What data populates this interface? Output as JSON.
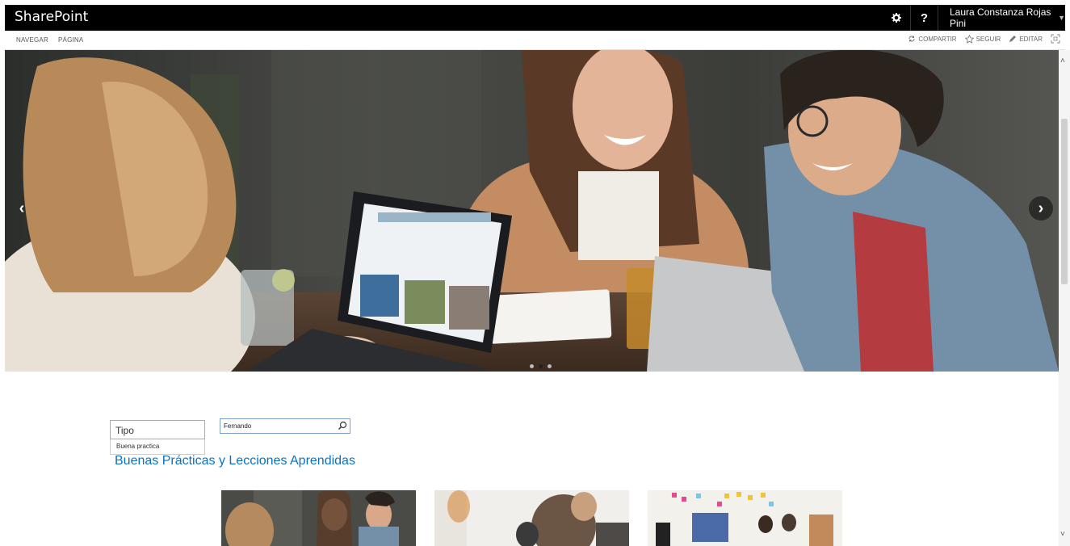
{
  "topbar": {
    "brand": "SharePoint",
    "help_label": "?",
    "user_name": "Laura Constanza Rojas Pini",
    "gear_icon": "gear-icon"
  },
  "ribbon": {
    "tabs": [
      "NAVEGAR",
      "PÁGINA"
    ],
    "actions": [
      {
        "label": "COMPARTIR",
        "icon": "share-icon"
      },
      {
        "label": "SEGUIR",
        "icon": "star-icon"
      },
      {
        "label": "EDITAR",
        "icon": "pencil-icon"
      }
    ],
    "focus_icon": "focus-mode-icon"
  },
  "hero": {
    "slide_count": 3,
    "active_slide": 2,
    "image_description_icon": "hero-photo"
  },
  "filters": {
    "tipo_label": "Tipo",
    "tipo_option": "Buena practica",
    "search_value": "Fernando"
  },
  "section": {
    "title": "Buenas Prácticas y Lecciones Aprendidas"
  },
  "colors": {
    "topbar": "#000000",
    "title": "#0a72c2",
    "search_border": "#7a9fc9"
  }
}
